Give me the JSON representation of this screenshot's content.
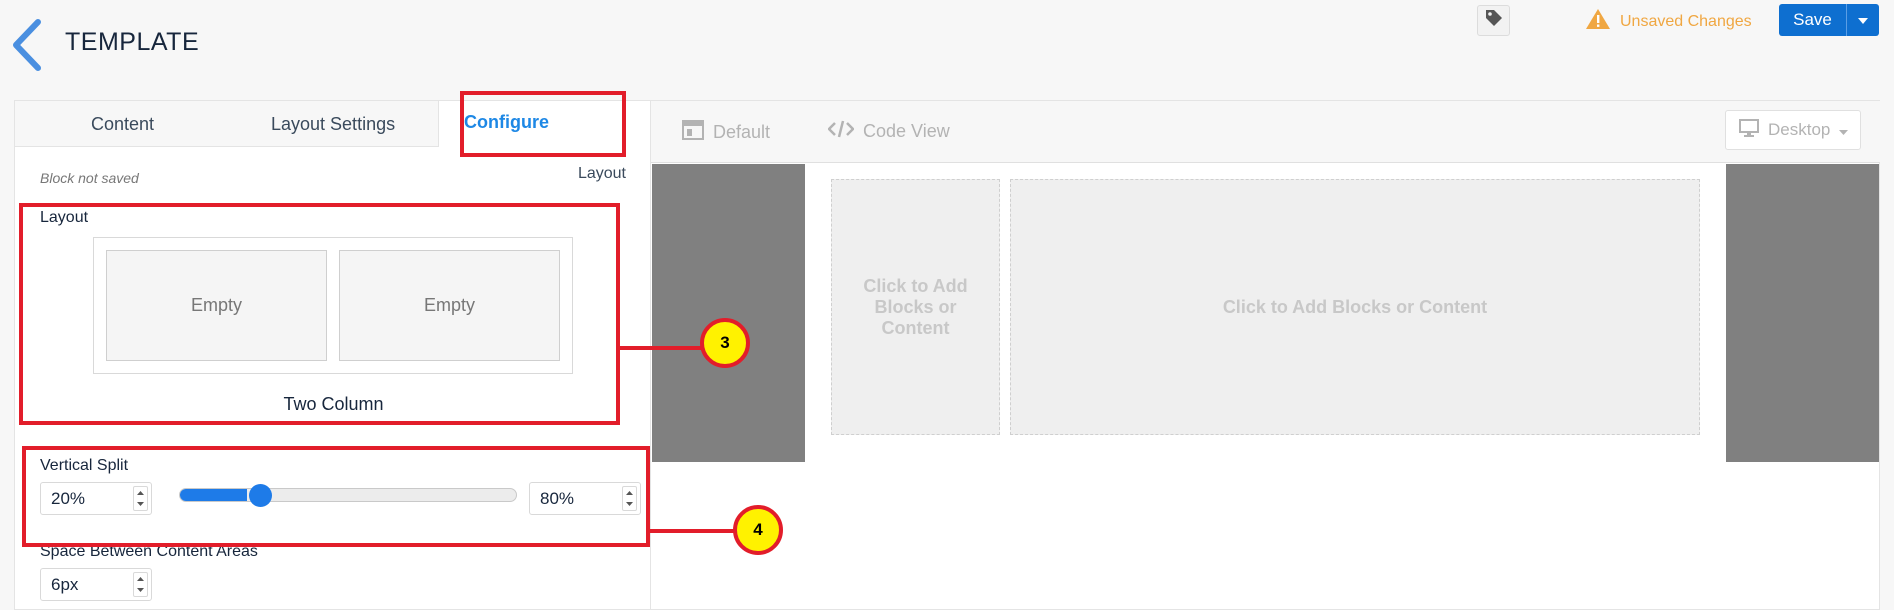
{
  "header": {
    "title": "TEMPLATE",
    "unsaved_label": "Unsaved Changes",
    "save_label": "Save"
  },
  "left_panel": {
    "tabs": [
      "Content",
      "Layout Settings",
      "Configure"
    ],
    "active_tab": "Configure",
    "status": "Block not saved",
    "layout_link": "Layout",
    "layout_section_label": "Layout",
    "columns": [
      "Empty",
      "Empty"
    ],
    "layout_name": "Two Column",
    "vertical_split": {
      "label": "Vertical Split",
      "left_value": "20%",
      "right_value": "80%",
      "slider_fraction": 0.2
    },
    "spacing": {
      "label": "Space Between Content Areas",
      "value": "6px"
    }
  },
  "editor": {
    "toolbar": {
      "default_label": "Default",
      "code_view_label": "Code View",
      "device_label": "Desktop"
    },
    "canvas": {
      "left_zone_text": "Click to Add Blocks or Content",
      "right_zone_text": "Click to Add Blocks or Content"
    }
  },
  "annotations": [
    {
      "number": "3"
    },
    {
      "number": "4"
    }
  ],
  "colors": {
    "accent": "#1e88e5",
    "save": "#0e6fd0",
    "warning": "#f0a742",
    "annotation": "#e21d2a",
    "badge": "#fff200"
  }
}
